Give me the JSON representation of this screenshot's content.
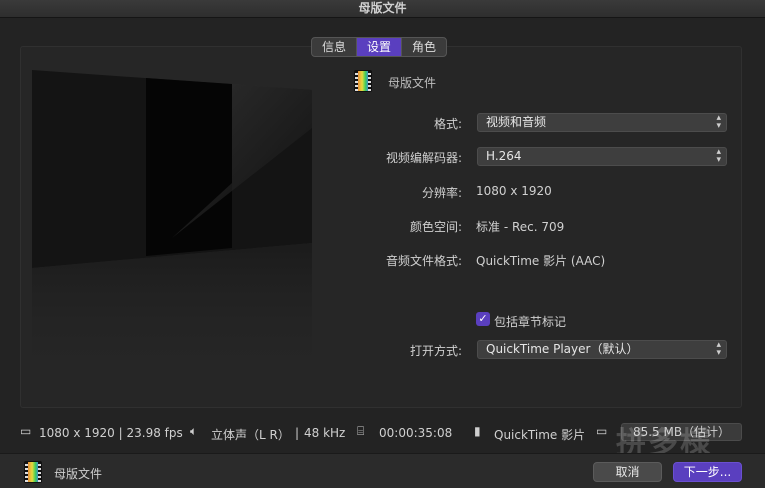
{
  "window": {
    "title": "母版文件"
  },
  "tabs": [
    {
      "label": "信息",
      "active": false
    },
    {
      "label": "设置",
      "active": true
    },
    {
      "label": "角色",
      "active": false
    }
  ],
  "settings": {
    "preset_name": "母版文件",
    "format": {
      "label": "格式:",
      "value": "视频和音频"
    },
    "video_codec": {
      "label": "视频编解码器:",
      "value": "H.264"
    },
    "resolution": {
      "label": "分辨率:",
      "value": "1080 x 1920"
    },
    "color_space": {
      "label": "颜色空间:",
      "value": "标准 - Rec. 709"
    },
    "audio_format": {
      "label": "音频文件格式:",
      "value": "QuickTime 影片 (AAC)"
    },
    "chapter_markers": {
      "label": "包括章节标记",
      "checked": true
    },
    "open_with": {
      "label": "打开方式:",
      "value": "QuickTime Player（默认）"
    }
  },
  "status": {
    "resolution_fps": "1080 x 1920 | 23.98 fps",
    "audio": "立体声（L R）",
    "sample_rate": "48 kHz",
    "duration": "00:00:35:08",
    "file_type": "QuickTime 影片",
    "size": "85.5 MB（估计）"
  },
  "footer": {
    "name": "母版文件",
    "cancel_label": "取消",
    "next_label": "下一步..."
  },
  "watermark": "拼多様",
  "colors": {
    "accent": "#5a3fbf",
    "background": "#232323"
  }
}
